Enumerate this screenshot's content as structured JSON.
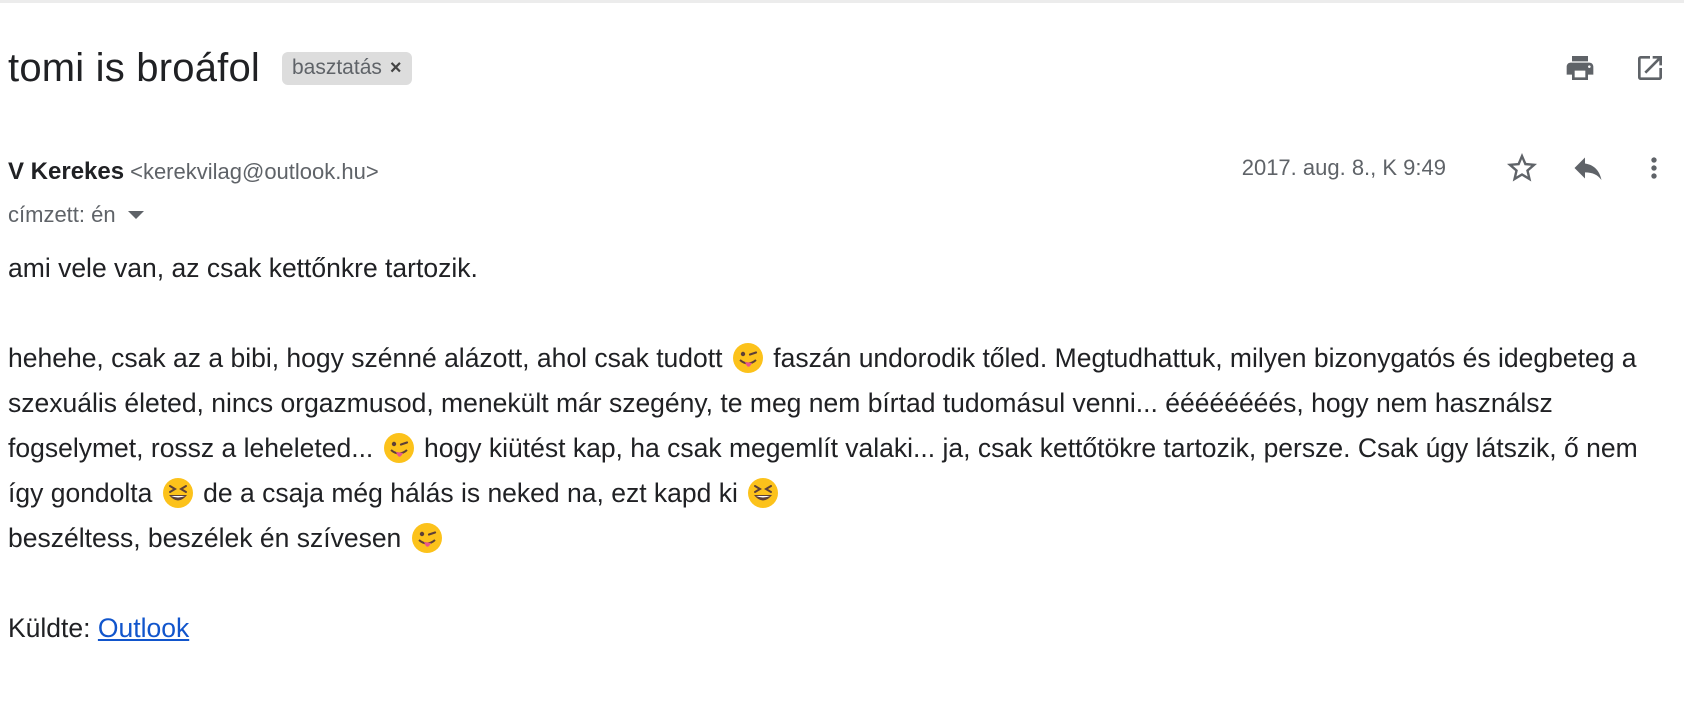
{
  "email": {
    "subject": "tomi is broáfol",
    "label": "basztatás",
    "label_remove": "×",
    "sender_name": "V Kerekes",
    "sender_email": "<kerekvilag@outlook.hu>",
    "recipient": "címzett: én",
    "date": "2017. aug. 8., K 9:49"
  },
  "body": {
    "line1": "ami vele van, az csak kettőnkre tartozik.",
    "p2_a": "hehehe, csak az a bibi, hogy szénné alázott, ahol csak tudott",
    "p2_b": "faszán undorodik tőled. Megtudhattuk, milyen bizonygatós és idegbeteg a szexuális életed,  nincs orgazmusod, menekült már szegény, te meg nem bírtad tudomásul venni... éééééééés, hogy nem használsz fogselymet, rossz a leheleted...",
    "p2_c": "hogy kiütést kap, ha csak megemlít valaki... ja, csak kettőtökre tartozik, persze. Csak úgy látszik, ő nem így gondolta",
    "p2_d": "de a csaja még hálás is neked na, ezt kapd ki",
    "p2_e": "beszéltess, beszélek én szívesen",
    "signature_prefix": "Küldte:",
    "signature_link": "Outlook"
  },
  "icons": {
    "print": "print-icon",
    "open_new_window": "open-in-new-icon",
    "star": "star-icon",
    "reply": "reply-icon",
    "more": "more-vert-icon",
    "tongue_wink": "winking-tongue-emoji",
    "laugh": "grinning-squinting-emoji"
  },
  "colors": {
    "link": "#1155cc",
    "chip_bg": "#dddddd",
    "muted": "#5f6368",
    "icon": "#5f6368"
  }
}
